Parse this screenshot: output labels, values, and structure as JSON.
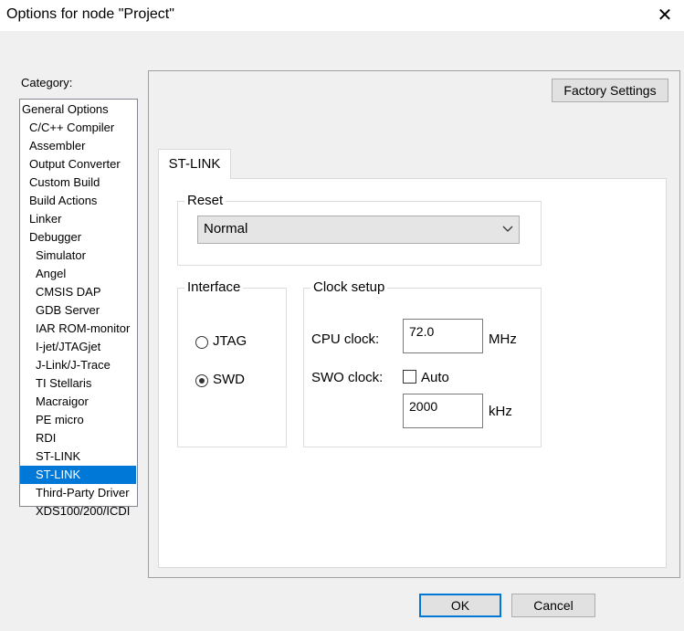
{
  "window": {
    "title": "Options for node \"Project\"",
    "close_glyph": "✕"
  },
  "category": {
    "label": "Category:",
    "selected_index": 20,
    "items": [
      {
        "label": "General Options",
        "indent": 0
      },
      {
        "label": "C/C++ Compiler",
        "indent": 1
      },
      {
        "label": "Assembler",
        "indent": 1
      },
      {
        "label": "Output Converter",
        "indent": 1
      },
      {
        "label": "Custom Build",
        "indent": 1
      },
      {
        "label": "Build Actions",
        "indent": 1
      },
      {
        "label": "Linker",
        "indent": 1
      },
      {
        "label": "Debugger",
        "indent": 1
      },
      {
        "label": "Simulator",
        "indent": 2
      },
      {
        "label": "Angel",
        "indent": 2
      },
      {
        "label": "CMSIS DAP",
        "indent": 2
      },
      {
        "label": "GDB Server",
        "indent": 2
      },
      {
        "label": "IAR ROM-monitor",
        "indent": 2
      },
      {
        "label": "I-jet/JTAGjet",
        "indent": 2
      },
      {
        "label": "J-Link/J-Trace",
        "indent": 2
      },
      {
        "label": "TI Stellaris",
        "indent": 2
      },
      {
        "label": "Macraigor",
        "indent": 2
      },
      {
        "label": "PE micro",
        "indent": 2
      },
      {
        "label": "RDI",
        "indent": 2
      },
      {
        "label": "ST-LINK",
        "indent": 2
      },
      {
        "label": "ST-LINK",
        "indent": 2
      },
      {
        "label": "Third-Party Driver",
        "indent": 2
      },
      {
        "label": "XDS100/200/ICDI",
        "indent": 2
      }
    ]
  },
  "factory_settings_label": "Factory Settings",
  "tabs": [
    {
      "label": "ST-LINK"
    }
  ],
  "reset": {
    "legend": "Reset",
    "value": "Normal"
  },
  "interface": {
    "legend": "Interface",
    "options": [
      {
        "label": "JTAG",
        "selected": false
      },
      {
        "label": "SWD",
        "selected": true
      }
    ]
  },
  "clock": {
    "legend": "Clock setup",
    "cpu_label": "CPU clock:",
    "cpu_value": "72.0",
    "cpu_unit": "MHz",
    "swo_label": "SWO clock:",
    "auto_label": "Auto",
    "auto_checked": false,
    "swo_value": "2000",
    "swo_unit": "kHz"
  },
  "buttons": {
    "ok": "OK",
    "cancel": "Cancel"
  },
  "colors": {
    "selection": "#0078d7",
    "default_button_border": "#0078d7"
  }
}
